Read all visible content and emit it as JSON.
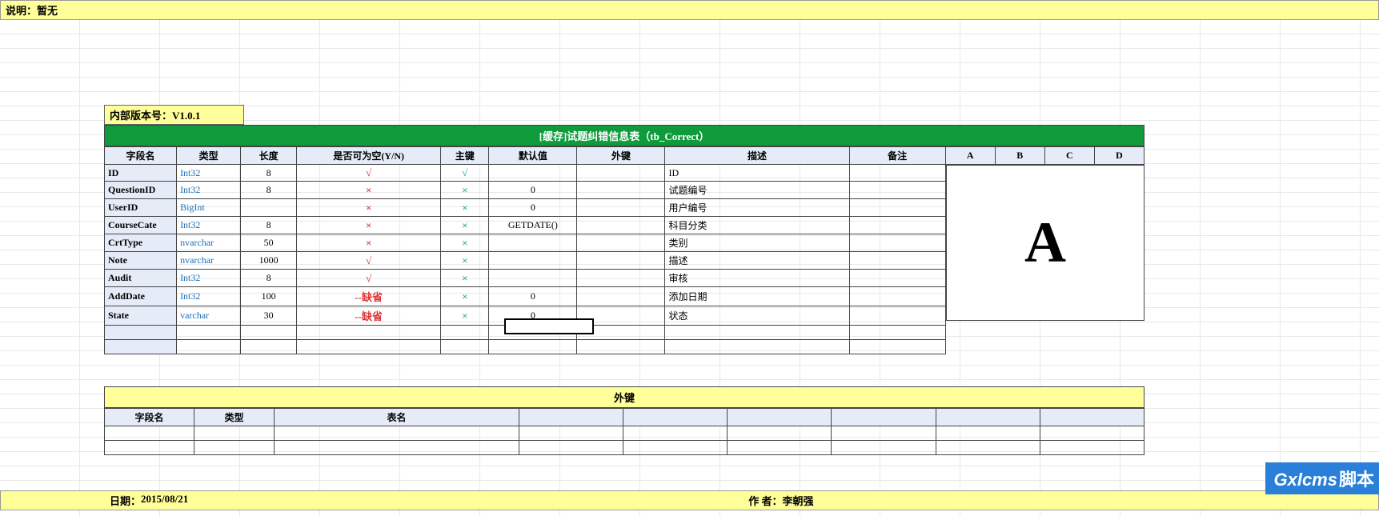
{
  "topbar": {
    "label": "说明：",
    "value": "暂无"
  },
  "version": {
    "label": "内部版本号：",
    "value": "V1.0.1"
  },
  "main_table": {
    "title": "[缓存]试题纠错信息表（tb_Correct）",
    "headers": {
      "field": "字段名",
      "type": "类型",
      "length": "长度",
      "nullable": "是否可为空(Y/N)",
      "pk": "主键",
      "default": "默认值",
      "fk": "外键",
      "desc": "描述",
      "remark": "备注",
      "a": "A",
      "b": "B",
      "c": "C",
      "d": "D"
    },
    "rows": [
      {
        "field": "ID",
        "type": "Int32",
        "length": "8",
        "nullable": "check-red",
        "pk": "check-blue",
        "default": "",
        "fk": "",
        "desc": "ID"
      },
      {
        "field": "QuestionID",
        "type": "Int32",
        "length": "8",
        "nullable": "x-red",
        "pk": "x-blue",
        "default": "0",
        "fk": "",
        "desc": "试题编号"
      },
      {
        "field": "UserID",
        "type": "BigInt",
        "length": "",
        "nullable": "x-red",
        "pk": "x-blue",
        "default": "0",
        "fk": "",
        "desc": "用户编号"
      },
      {
        "field": "CourseCate",
        "type": "Int32",
        "length": "8",
        "nullable": "x-red",
        "pk": "x-blue",
        "default": "GETDATE()",
        "fk": "",
        "desc": "科目分类"
      },
      {
        "field": "CrtType",
        "type": "nvarchar",
        "length": "50",
        "nullable": "x-red",
        "pk": "x-blue",
        "default": "",
        "fk": "",
        "desc": "类别"
      },
      {
        "field": "Note",
        "type": "nvarchar",
        "length": "1000",
        "nullable": "check-red",
        "pk": "x-blue",
        "default": "",
        "fk": "",
        "desc": "描述"
      },
      {
        "field": "Audit",
        "type": "Int32",
        "length": "8",
        "nullable": "check-red",
        "pk": "x-blue",
        "default": "",
        "fk": "",
        "desc": "审核"
      },
      {
        "field": "AddDate",
        "type": "Int32",
        "length": "100",
        "nullable": "--缺省",
        "pk": "x-blue",
        "default": "0",
        "fk": "",
        "desc": "添加日期"
      },
      {
        "field": "State",
        "type": "varchar",
        "length": "30",
        "nullable": "--缺省",
        "pk": "x-blue",
        "default": "0",
        "fk": "",
        "desc": "状态"
      }
    ]
  },
  "big_letter": "A",
  "fk_table": {
    "title": "外键",
    "headers": {
      "field": "字段名",
      "type": "类型",
      "table": "表名"
    }
  },
  "footer": {
    "date_label": "日期：",
    "date": "2015/08/21",
    "author_label": "作 者：",
    "author": "李朝强"
  },
  "watermark": {
    "en": "Gxlcms",
    "cn": "脚本"
  }
}
